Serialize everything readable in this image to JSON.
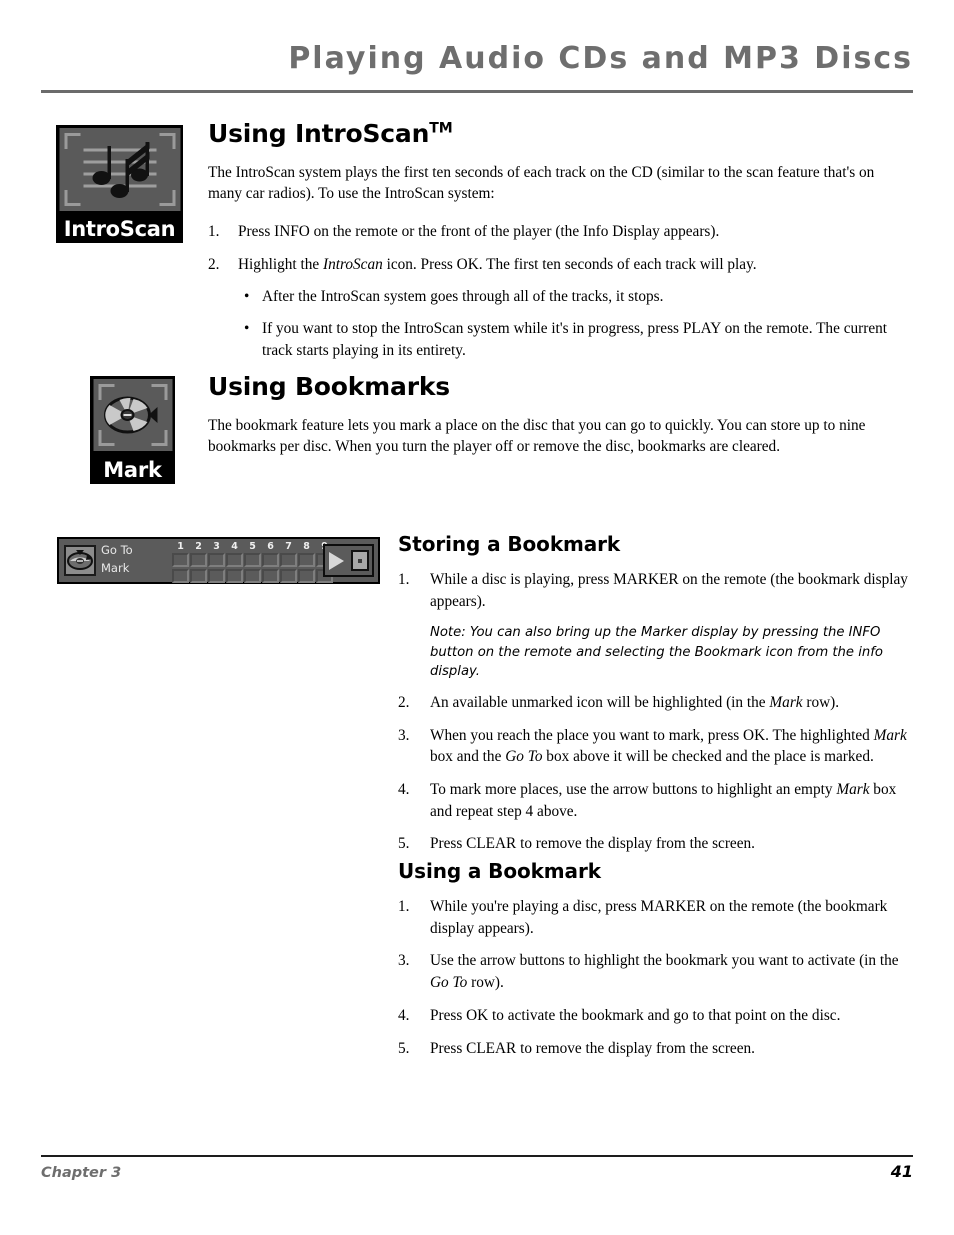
{
  "header": {
    "title": "Playing Audio CDs and MP3 Discs"
  },
  "introscan": {
    "icon_label": "IntroScan",
    "heading": "Using IntroScan",
    "heading_tm": "TM",
    "intro_paragraph": "The IntroScan system plays the first ten seconds of each track on the CD (similar to the scan feature that's on many car radios). To use the IntroScan system:",
    "steps": [
      {
        "num": "1.",
        "text": "Press INFO on the remote or the front of the player (the Info Display appears)."
      },
      {
        "num": "2.",
        "text_before": "Highlight the ",
        "emphasis": "IntroScan",
        "text_after": " icon. Press OK. The first ten seconds of each track will play."
      }
    ],
    "bullets": [
      {
        "bullet": "•",
        "text": "After the IntroScan system goes through all of the tracks, it stops."
      },
      {
        "bullet": "•",
        "text": "If you want to stop the IntroScan system while it's in progress, press PLAY on the remote. The current track starts playing in its entirety."
      }
    ]
  },
  "bookmarks": {
    "icon_label": "Mark",
    "heading": "Using Bookmarks",
    "paragraph": "The bookmark feature lets you mark a place on the disc that you can go to quickly. You can store up to nine bookmarks per disc. When you turn the player off or remove the disc, bookmarks are cleared."
  },
  "osd": {
    "go_to_label": "Go To",
    "mark_label": "Mark",
    "numbers": [
      "1",
      "2",
      "3",
      "4",
      "5",
      "6",
      "7",
      "8",
      "9"
    ],
    "go_to_cells": [
      "",
      "",
      "",
      "",
      "",
      "",
      "",
      "",
      ""
    ],
    "mark_cells": [
      "",
      "",
      "",
      "",
      "",
      "",
      "",
      "",
      ""
    ],
    "transport_icons": [
      "play-icon",
      "stop-icon"
    ]
  },
  "storing": {
    "heading": "Storing a Bookmark",
    "steps": [
      {
        "num": "1.",
        "text": "While a disc is playing, press MARKER on the remote (the bookmark display appears)."
      },
      {
        "num": "2.",
        "text_before": "An available unmarked icon will be highlighted (in the ",
        "emphasis": "Mark",
        "text_after": " row)."
      },
      {
        "num": "3.",
        "text_before": "When you reach the place you want to mark, press OK. The highlighted ",
        "emphasis": "Mark",
        "text_mid": " box and the ",
        "emphasis2": "Go To",
        "text_after": " box above it will be checked and the place is marked."
      },
      {
        "num": "4.",
        "text_before": "To mark more places, use the arrow buttons to highlight an empty ",
        "emphasis": "Mark",
        "text_after": " box and repeat step 4 above."
      },
      {
        "num": "5.",
        "text": "Press CLEAR to remove the display from the screen."
      }
    ],
    "note": "Note: You can also bring up the Marker display by pressing the INFO button on the remote and selecting the Bookmark icon from the info display."
  },
  "using": {
    "heading": "Using a Bookmark",
    "steps": [
      {
        "num": "1.",
        "text": "While you're playing a disc, press MARKER on the remote (the bookmark display appears)."
      },
      {
        "num": "3.",
        "text_before": "Use the arrow buttons to highlight the bookmark you want to activate (in the ",
        "emphasis": "Go To",
        "text_after": " row)."
      },
      {
        "num": "4.",
        "text": "Press OK to activate the bookmark and go to that point on the disc."
      },
      {
        "num": "5.",
        "text": "Press CLEAR to remove the display from the screen."
      }
    ]
  },
  "footer": {
    "chapter": "Chapter 3",
    "page_number": "41"
  },
  "colors": {
    "header_gray": "#6e6e6e",
    "rule_gray": "#6b6b6b",
    "osd_background": "#5b5b5b",
    "icon_tile": "#5a5a5a",
    "icon_black": "#000000"
  }
}
